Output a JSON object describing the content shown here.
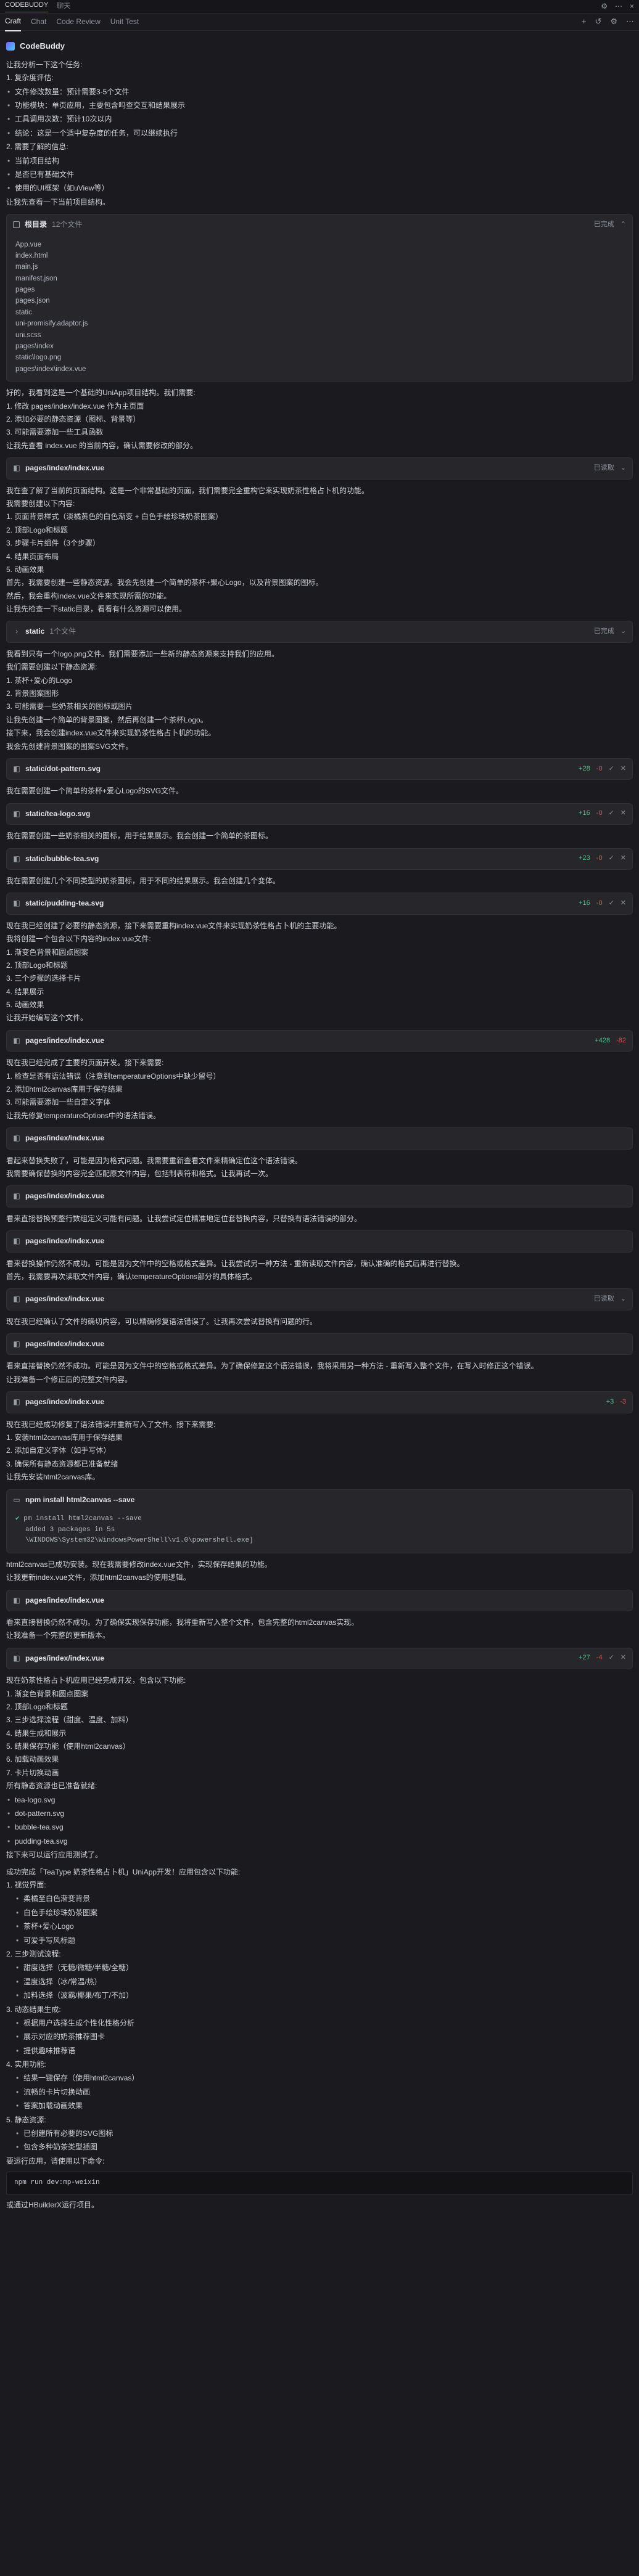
{
  "titlebar": {
    "app": "CODEBUDDY",
    "tab2": "聊天"
  },
  "tabs": [
    "Craft",
    "Chat",
    "Code Review",
    "Unit Test"
  ],
  "agent": "CodeBuddy",
  "intro": {
    "line1": "让我分析一下这个任务:",
    "line2": "1. 复杂度评估:",
    "b1": "文件修改数量：预计需要3-5个文件",
    "b2": "功能模块：单页应用，主要包含吗查交互和结果展示",
    "b3": "工具调用次数：预计10次以内",
    "b4": "结论：这是一个适中复杂度的任务，可以继续执行",
    "line3": "2. 需要了解的信息:",
    "b5": "当前项目结构",
    "b6": "是否已有基础文件",
    "b7": "使用的UI框架（如uView等）",
    "line4": "让我先查看一下当前项目结构。"
  },
  "card_dir": {
    "name": "根目录",
    "count": "12个文件",
    "status": "已完成",
    "files": [
      "App.vue",
      "index.html",
      "main.js",
      "manifest.json",
      "pages",
      "pages.json",
      "static",
      "uni-promisify.adaptor.js",
      "uni.scss",
      "pages\\index",
      "static\\logo.png",
      "pages\\index\\index.vue"
    ]
  },
  "p2": {
    "l1": "好的，我看到这是一个基础的UniApp项目结构。我们需要:",
    "l2": "1. 修改 pages/index/index.vue 作为主页面",
    "l3": "2. 添加必要的静态资源（图标、背景等）",
    "l4": "3. 可能需要添加一些工具函数",
    "l5": "让我先查看 index.vue 的当前内容，确认需要修改的部分。"
  },
  "card_idx1": {
    "name": "pages/index/index.vue",
    "status": "已读取"
  },
  "p3": {
    "l1": "我在查了解了当前的页面结构。这是一个非常基础的页面，我们需要完全重构它来实现奶茶性格占卜机的功能。",
    "l2": "我需要创建以下内容:",
    "l3": "1. 页面背景样式（淡橘黄色的白色渐变 + 白色手绘珍珠奶茶图案）",
    "l4": "2. 顶部Logo和标题",
    "l5": "3. 步骤卡片组件（3个步骤）",
    "l6": "4. 结果页面布局",
    "l7": "5. 动画效果",
    "l8": "首先，我需要创建一些静态资源。我会先创建一个简单的茶杯+聚心Logo，以及背景图案的图标。",
    "l9": "然后，我会重构index.vue文件来实现所需的功能。",
    "l10": "让我先检查一下static目录，看看有什么资源可以使用。"
  },
  "card_static": {
    "name": "static",
    "count": "1个文件",
    "status": "已完成"
  },
  "p4": {
    "l1": "我看到只有一个logo.png文件。我们需要添加一些新的静态资源来支持我们的应用。",
    "l2": "我们需要创建以下静态资源:",
    "l3": "1. 茶杯+爱心的Logo",
    "l4": "2. 背景图案图形",
    "l5": "3. 可能需要一些奶茶相关的图标或图片",
    "l6": "让我先创建一个简单的背景图案，然后再创建一个茶杯Logo。",
    "l7": "接下来，我会创建index.vue文件来实现奶茶性格占卜机的功能。",
    "l8": "我会先创建背景图案的图案SVG文件。"
  },
  "card_dot": {
    "name": "static/dot-pattern.svg",
    "add": "+28",
    "del": "-0"
  },
  "p5": "我在需要创建一个简单的茶杯+爱心Logo的SVG文件。",
  "card_tea": {
    "name": "static/tea-logo.svg",
    "add": "+16",
    "del": "-0"
  },
  "p6": "我在需要创建一些奶茶相关的图标，用于结果展示。我会创建一个简单的茶图标。",
  "card_bubble": {
    "name": "static/bubble-tea.svg",
    "add": "+23",
    "del": "-0"
  },
  "p7": "我在需要创建几个不同类型的奶茶图标，用于不同的结果展示。我会创建几个变体。",
  "card_pudding": {
    "name": "static/pudding-tea.svg",
    "add": "+16",
    "del": "-0"
  },
  "p8": {
    "l1": "现在我已经创建了必要的静态资源，接下来需要重构index.vue文件来实现奶茶性格占卜机的主要功能。",
    "l2": "我将创建一个包含以下内容的index.vue文件:",
    "l3": "1. 渐变色背景和圆点图案",
    "l4": "2. 顶部Logo和标题",
    "l5": "3. 三个步骤的选择卡片",
    "l6": "4. 结果展示",
    "l7": "5. 动画效果",
    "l8": "让我开始编写这个文件。"
  },
  "card_idx2": {
    "name": "pages/index/index.vue",
    "add": "+428",
    "del": "-82"
  },
  "p9": {
    "l1": "现在我已经完成了主要的页面开发。接下来需要:",
    "l2": "1. 检查是否有语法错误（注意到temperatureOptions中缺少留号）",
    "l3": "2. 添加html2canvas库用于保存结果",
    "l4": "3. 可能需要添加一些自定义字体",
    "l5": "让我先修复temperatureOptions中的语法错误。"
  },
  "card_idx3": {
    "name": "pages/index/index.vue"
  },
  "p10": {
    "l1": "看起来替换失败了，可能是因为格式问题。我需要重新查看文件来精确定位这个语法错误。",
    "l2": "我需要确保替换的内容完全匹配原文件内容，包括制表符和格式。让我再试一次。"
  },
  "card_idx4": {
    "name": "pages/index/index.vue"
  },
  "p11": "看来直接替换预整行数组定义可能有问题。让我尝试定位精准地定位套替换内容，只替换有语法错误的部分。",
  "card_idx5": {
    "name": "pages/index/index.vue"
  },
  "p12": {
    "l1": "看来替换操作仍然不成功。可能是因为文件中的空格或格式差异。让我尝试另一种方法 - 重新读取文件内容，确认准确的格式后再进行替换。",
    "l2": "首先，我需要再次读取文件内容，确认temperatureOptions部分的具体格式。"
  },
  "card_idx6": {
    "name": "pages/index/index.vue",
    "status": "已读取"
  },
  "p13": "现在我已经确认了文件的确切内容，可以精确修复语法错误了。让我再次尝试替换有问题的行。",
  "card_idx7": {
    "name": "pages/index/index.vue"
  },
  "p14": {
    "l1": "看来直接替换仍然不成功。可能是因为文件中的空格或格式差异。为了确保修复这个语法错误，我将采用另一种方法 - 重新写入整个文件，在写入时修正这个错误。",
    "l2": "让我准备一个修正后的完整文件内容。"
  },
  "card_idx8": {
    "name": "pages/index/index.vue",
    "add": "+3",
    "del": "-3"
  },
  "p15": {
    "l1": "现在我已经成功修复了语法错误并重新写入了文件。接下来需要:",
    "l2": "1. 安装html2canvas库用于保存结果",
    "l3": "2. 添加自定义字体（如手写体）",
    "l4": "3. 确保所有静态资源都已准备就绪",
    "l5": "让我先安装html2canvas库。"
  },
  "term": {
    "title": "npm install html2canvas --save",
    "cmd": "pm install html2canvas --save",
    "out1": "added 3 packages in 5s",
    "out2": "\\WINDOWS\\System32\\WindowsPowerShell\\v1.0\\powershell.exe]"
  },
  "p16": {
    "l1": "html2canvas已成功安装。现在我需要修改index.vue文件，实现保存结果的功能。",
    "l2": "让我更新index.vue文件，添加html2canvas的使用逻辑。"
  },
  "card_idx9": {
    "name": "pages/index/index.vue"
  },
  "p17": {
    "l1": "看来直接替换仍然不成功。为了确保实现保存功能，我将重新写入整个文件，包含完整的html2canvas实现。",
    "l2": "让我准备一个完整的更新版本。"
  },
  "card_idx10": {
    "name": "pages/index/index.vue",
    "add": "+27",
    "del": "-4"
  },
  "p18": {
    "l1": "现在奶茶性格占卜机应用已经完成开发，包含以下功能:",
    "l2": "1. 渐变色背景和圆点图案",
    "l3": "2. 顶部Logo和标题",
    "l4": "3. 三步选择流程（甜度、温度、加料）",
    "l5": "4. 结果生成和展示",
    "l6": "5. 结果保存功能（使用html2canvas）",
    "l7": "6. 加载动画效果",
    "l8": "7. 卡片切换动画",
    "l9": "所有静态资源也已准备就绪:",
    "r1": "tea-logo.svg",
    "r2": "dot-pattern.svg",
    "r3": "bubble-tea.svg",
    "r4": "pudding-tea.svg",
    "l10": "接下来可以运行应用测试了。"
  },
  "summary": {
    "title": "成功完成「TeaType 奶茶性格占卜机」UniApp开发！应用包含以下功能:",
    "s1": "1. 视觉界面:",
    "s1a": "柔橘至白色渐变背景",
    "s1b": "白色手绘珍珠奶茶图案",
    "s1c": "茶杯+爱心Logo",
    "s1d": "可爱手写风标题",
    "s2": "2. 三步测试流程:",
    "s2a": "甜度选择（无糖/微糖/半糖/全糖）",
    "s2b": "温度选择（冰/常温/热）",
    "s2c": "加料选择（波霸/椰果/布丁/不加）",
    "s3": "3. 动态结果生成:",
    "s3a": "根据用户选择生成个性化性格分析",
    "s3b": "展示对应的奶茶推荐图卡",
    "s3c": "提供趣味推荐语",
    "s4": "4. 实用功能:",
    "s4a": "结果一键保存（使用html2canvas）",
    "s4b": "流畅的卡片切换动画",
    "s4c": "答案加载动画效果",
    "s5": "5. 静态资源:",
    "s5a": "已创建所有必要的SVG图标",
    "s5b": "包含多种奶茶类型插图",
    "s6": "要运行应用，请使用以下命令:",
    "cmd": "npm run dev:mp-weixin",
    "end": "或通过HBuilderX运行项目。"
  }
}
